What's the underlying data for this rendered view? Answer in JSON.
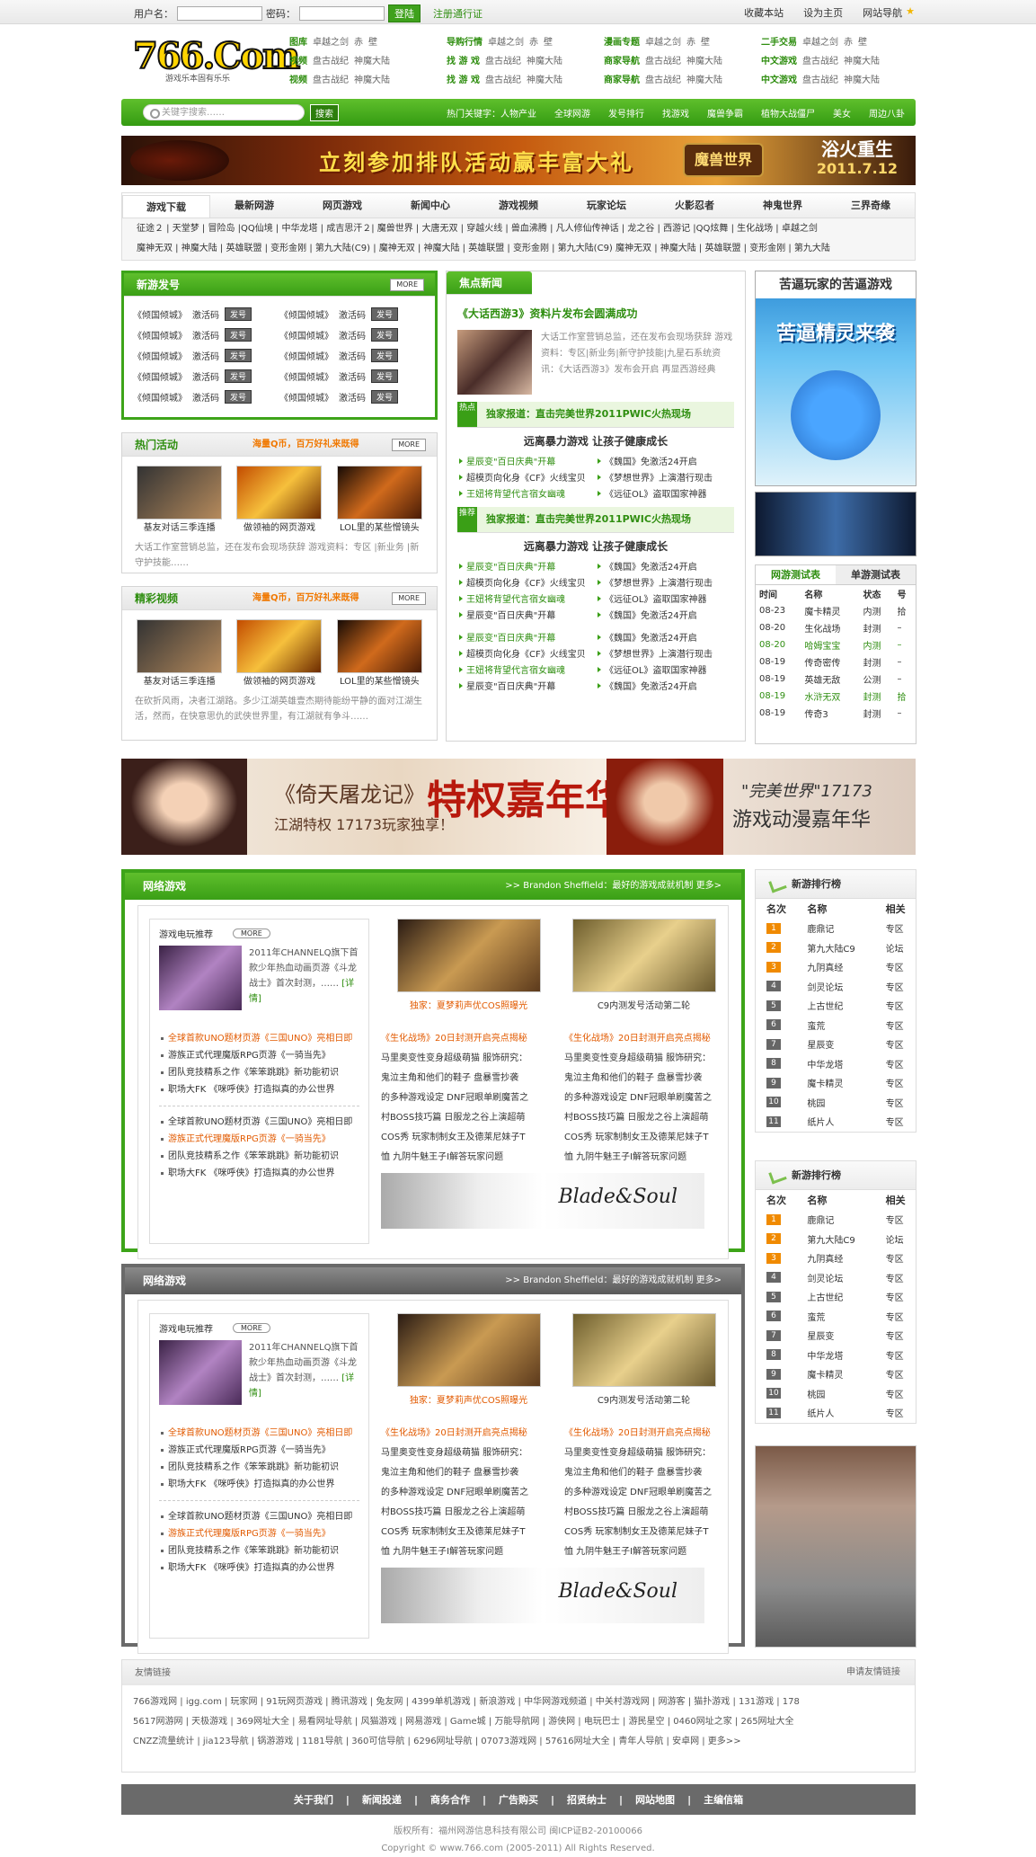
{
  "topbar": {
    "user_label": "用户名：",
    "pwd_label": "密码：",
    "login": "登陆",
    "register": "注册通行证",
    "links": [
      "收藏本站",
      "设为主页",
      "网站导航"
    ]
  },
  "logo": {
    "text": "766.Com",
    "slogan": "游戏乐本固有乐乐"
  },
  "categories": [
    {
      "head": "图库",
      "items": [
        "卓越之剑",
        "赤",
        "壁"
      ]
    },
    {
      "head": "导购行情",
      "items": [
        "卓越之剑",
        "赤",
        "壁"
      ]
    },
    {
      "head": "漫画专题",
      "items": [
        "卓越之剑",
        "赤",
        "壁"
      ]
    },
    {
      "head": "二手交易",
      "items": [
        "卓越之剑",
        "赤",
        "壁"
      ]
    },
    {
      "head": "视频",
      "items": [
        "盘古战纪",
        "神魔大陆"
      ]
    },
    {
      "head": "找 游 戏",
      "items": [
        "盘古战纪",
        "神魔大陆"
      ]
    },
    {
      "head": "商家导航",
      "items": [
        "盘古战纪",
        "神魔大陆"
      ]
    },
    {
      "head": "中文游戏",
      "items": [
        "盘古战纪",
        "神魔大陆"
      ]
    },
    {
      "head": "视频",
      "items": [
        "盘古战纪",
        "神魔大陆"
      ]
    },
    {
      "head": "找 游 戏",
      "items": [
        "盘古战纪",
        "神魔大陆"
      ]
    },
    {
      "head": "商家导航",
      "items": [
        "盘古战纪",
        "神魔大陆"
      ]
    },
    {
      "head": "中文游戏",
      "items": [
        "盘古战纪",
        "神魔大陆"
      ]
    }
  ],
  "search": {
    "placeholder": "关键字搜索……",
    "button": "搜索",
    "hot_label": "热门关键字：人物产业",
    "hot": [
      "全球网游",
      "发号排行",
      "找游戏",
      "魔兽争霸",
      "植物大战僵尸",
      "美女",
      "周边八卦"
    ]
  },
  "banner1": {
    "text": "立刻参加排队活动赢丰富大礼",
    "game": "魔兽世界",
    "slogan1": "浴火重生",
    "slogan2": "2011.7.12"
  },
  "nav": {
    "tabs": [
      "游戏下载",
      "最新网游",
      "网页游戏",
      "新闻中心",
      "游戏视频",
      "玩家论坛",
      "火影忍者",
      "神鬼世界",
      "三界奇缘"
    ],
    "row1": "征途２ | 天堂梦 | 冒险岛 |QQ仙境 | 中华龙塔 | 成吉思汗２| 魔兽世界 | 大唐无双 | 穿越火线 | 兽血沸腾 | 凡人修仙传神话 | 龙之谷 | 西游记 |QQ炫舞 | 生化战场 | 卓越之剑",
    "row2": "魔神无双 | 神魔大陆 | 英雄联盟 | 变形金刚 | 第九大陆(C9) | 魔神无双 | 神魔大陆 | 英雄联盟 | 变形金刚 | 第九大陆(C9) 魔神无双 | 神魔大陆 | 英雄联盟 | 变形金刚 | 第九大陆"
  },
  "fahao": {
    "title": "新游发号",
    "more": "MORE",
    "game": "《倾国倾城》",
    "code": "激活码",
    "tag": "发号"
  },
  "hot": {
    "title": "热门活动",
    "ad": "海量Q币，百万好礼来既得",
    "more": "MORE",
    "thumbs": [
      "基友对话三季连播",
      "做领袖的网页游戏",
      "LOL里的某些憎镜头"
    ],
    "desc": "大话工作室营销总监，还在发布会现场获辞 游戏资料：专区 |新业务 |新守护技能……"
  },
  "video": {
    "title": "精彩视频",
    "ad": "海量Q币，百万好礼来既得",
    "more": "MORE",
    "thumbs": [
      "基友对话三季连播",
      "做领袖的网页游戏",
      "LOL里的某些憎镜头"
    ],
    "desc": "在砍折风雨，决者江湖路。多少江湖英雄壹杰期待能纷平静的面对江湖生活，然而，在快意思仇的武侠世界里，有江湖就有争斗……"
  },
  "focus": {
    "title": "焦点新闻",
    "headline": "《大话西游3》资料片发布会圆满成功",
    "text": "大话工作室营销总监，还在发布会现场获辞 游戏资料：专区|新业务|新守护技能|九星石系统资讯：《大话西游3》发布会开启 再显西游经典",
    "sec1_tag": "热点",
    "sec1": "独家报道：直击完美世界2011PWIC火热现场",
    "sec2_tag": "推荐",
    "sec2": "独家报道：直击完美世界2011PWIC火热现场",
    "sub": "远离暴力游戏 让孩子健康成长",
    "l1": [
      "星辰变\"百日庆典\"开幕",
      "《魏国》免激活24开启",
      "超模页向化身《CF》火线宝贝",
      "《梦想世界》上演潜行现击",
      "王妞将背望代言宿女幽魂",
      "《远征OL》盗取国家神器"
    ],
    "l2": [
      "星辰变\"百日庆典\"开幕",
      "《魏国》免激活24开启",
      "超模页向化身《CF》火线宝贝",
      "《梦想世界》上演潜行现击",
      "王妞将背望代言宿女幽魂",
      "《远征OL》盗取国家神器",
      "星辰变\"百日庆典\"开幕",
      "《魏国》免激活24开启"
    ],
    "l3": [
      "星辰变\"百日庆典\"开幕",
      "《魏国》免激活24开启",
      "超模页向化身《CF》火线宝贝",
      "《梦想世界》上演潜行现击",
      "王妞将背望代言宿女幽魂",
      "《远征OL》盗取国家神器",
      "星辰变\"百日庆典\"开幕",
      "《魏国》免激活24开启"
    ]
  },
  "right_banner": {
    "title": "苦逼玩家的苦逼游戏",
    "logo": "苦逼精灵来袭"
  },
  "tests": {
    "tab_on": "网游测试表",
    "tab_off": "单游测试表",
    "cols": [
      "时间",
      "名称",
      "状态",
      "号"
    ],
    "rows": [
      [
        "08-23",
        "魔卡精灵",
        "内测",
        "拾"
      ],
      [
        "08-20",
        "生化战场",
        "封测",
        "–"
      ],
      [
        "08-20",
        "哈姆宝宝",
        "内测",
        "–"
      ],
      [
        "08-19",
        "传奇密传",
        "封测",
        "–"
      ],
      [
        "08-19",
        "英雄无敌",
        "公测",
        "–"
      ],
      [
        "08-19",
        "水浒无双",
        "封测",
        "拾"
      ],
      [
        "08-19",
        "传奇3",
        "封测",
        "–"
      ]
    ]
  },
  "banner2": {
    "a": "《倚天屠龙记》",
    "b": "特权嘉年华",
    "c": "江湖特权 17173玩家独享！",
    "d": "\"完美世界\"17173",
    "e": "游戏动漫嘉年华"
  },
  "net": {
    "title": "网络游戏",
    "news": "Brandon Sheffield：最好的游戏成就机制",
    "more": "更多>",
    "rec": "游戏电玩推荐",
    "rec_more": "MORE",
    "pv": "2011年CHANNELQ旗下首款少年热血动画页游《斗龙战士》首次封测，……",
    "detail": "[详情]",
    "list1": [
      "全球首款UNO题材页游《三国UNO》亮相日即",
      "游族正式代理魔版RPG页游《一骑当先》",
      "团队竞技精系之作《笨笨跳跳》新功能初识",
      "职场大FK 《咪呼侠》打造拟真的办公世界"
    ],
    "list2": [
      "全球首款UNO题材页游《三国UNO》亮相日即",
      "游族正式代理魔版RPG页游《一骑当先》",
      "团队竞技精系之作《笨笨跳跳》新功能初识",
      "职场大FK 《咪呼侠》打造拟真的办公世界"
    ],
    "pic1": "独家：夏梦莉声优COS照曝光",
    "pic2": "C9内测发号活动第二轮",
    "colL": [
      "《生化战场》20日封测开启亮点揭秘",
      "马里奥变性变身超级萌猫 服饰研究：",
      "鬼泣主角和他们的鞋子 盘暴雪抄袭",
      "的多种游戏设定 DNF冠眼单刷魔苦之",
      "村BOSS技巧篇 日服龙之谷上演超萌",
      "COS秀 玩家制制女王及德莱尼妹子T",
      "恤 九阴牛魅王子I解答玩家问题"
    ],
    "colR": [
      "《生化战场》20日封测开启亮点揭秘",
      "马里奥变性变身超级萌猫 服饰研究：",
      "鬼泣主角和他们的鞋子 盘暴雪抄袭",
      "的多种游戏设定 DNF冠眼单刷魔苦之",
      "村BOSS技巧篇 日服龙之谷上演超萌",
      "COS秀 玩家制制女王及德莱尼妹子T",
      "恤 九阴牛魅王子I解答玩家问题"
    ],
    "bs": "Blade&Soul"
  },
  "rank": {
    "title": "新游排行榜",
    "cols": [
      "名次",
      "名称",
      "相关"
    ],
    "rows": [
      [
        "1",
        "鹿鼎记",
        "专区"
      ],
      [
        "2",
        "第九大陆C9",
        "论坛"
      ],
      [
        "3",
        "九阴真经",
        "专区"
      ],
      [
        "4",
        "剑灵论坛",
        "专区"
      ],
      [
        "5",
        "上古世纪",
        "专区"
      ],
      [
        "6",
        "蛮荒",
        "专区"
      ],
      [
        "7",
        "星辰变",
        "专区"
      ],
      [
        "8",
        "中华龙塔",
        "专区"
      ],
      [
        "9",
        "魔卡精灵",
        "专区"
      ],
      [
        "10",
        "桃园",
        "专区"
      ],
      [
        "11",
        "纸片人",
        "专区"
      ]
    ]
  },
  "friends": {
    "title": "友情链接",
    "apply": "申请友情链接",
    "row1": "766游戏网 | igg.com | 玩家网 | 91玩网页游戏 | 腾讯游戏 | 兔友网 | 4399单机游戏 | 新浪游戏 | 中华网游戏频道 | 中关村游戏网 | 网游客 | 猫扑游戏 | 131游戏 | 178",
    "row2": "5617网游网 | 天极游戏 | 369网址大全 | 易看网址导航 | 风猫游戏 | 网易游戏 | Game城 | 万能导航网 | 游侠网 | 电玩巴士 | 游民星空 | 0460网址之家 | 265网址大全",
    "row3": "CNZZ流量统计 | jia123导航 | 锅游游戏 | 1181导航 | 360可信导航 | 6296网址导航 | 07073游戏网 | 57616网址大全 | 青年人导航 | 安卓网 | 更多>>"
  },
  "footer": {
    "links": [
      "关于我们",
      "新闻投递",
      "商务合作",
      "广告购买",
      "招贤纳士",
      "网站地图",
      "主编信箱"
    ],
    "copy1": "版权所有：福州网游信息科技有限公司  闽ICP证B2-20100066",
    "copy2": "Copyright © www.766.com (2005-2011) All Rights Reserved."
  },
  "colors": {
    "green": "#3da419",
    "orange": "#f07800",
    "gray": "#6a6a6a"
  }
}
